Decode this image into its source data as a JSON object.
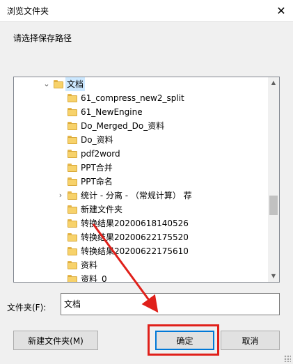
{
  "window": {
    "title": "浏览文件夹",
    "close_glyph": "✕"
  },
  "prompt": "请选择保存路径",
  "tree": {
    "items": [
      {
        "label": "文档",
        "level": 0,
        "expanded": true,
        "selected": true
      },
      {
        "label": "61_compress_new2_split",
        "level": 1
      },
      {
        "label": "61_NewEngine",
        "level": 1
      },
      {
        "label": "Do_Merged_Do_资料",
        "level": 1
      },
      {
        "label": "Do_资料",
        "level": 1
      },
      {
        "label": "pdf2word",
        "level": 1
      },
      {
        "label": "PPT合并",
        "level": 1
      },
      {
        "label": "PPT命名",
        "level": 1
      },
      {
        "label": "统计 - 分离 - （常规计算） 荐",
        "level": 1,
        "has_children": true
      },
      {
        "label": "新建文件夹",
        "level": 1
      },
      {
        "label": "转换结果20200618140526",
        "level": 1
      },
      {
        "label": "转换结果20200622175520",
        "level": 1
      },
      {
        "label": "转换结果20200622175610",
        "level": 1
      },
      {
        "label": "资料",
        "level": 1
      },
      {
        "label": "资料_0",
        "level": 1
      }
    ]
  },
  "folder_field": {
    "label": "文件夹(F):",
    "value": "文档"
  },
  "buttons": {
    "new_folder": "新建文件夹(M)",
    "ok": "确定",
    "cancel": "取消"
  },
  "annotation": {
    "color": "#e0201a"
  },
  "colors": {
    "selection": "#cce8ff",
    "focus_border": "#0078d7"
  }
}
